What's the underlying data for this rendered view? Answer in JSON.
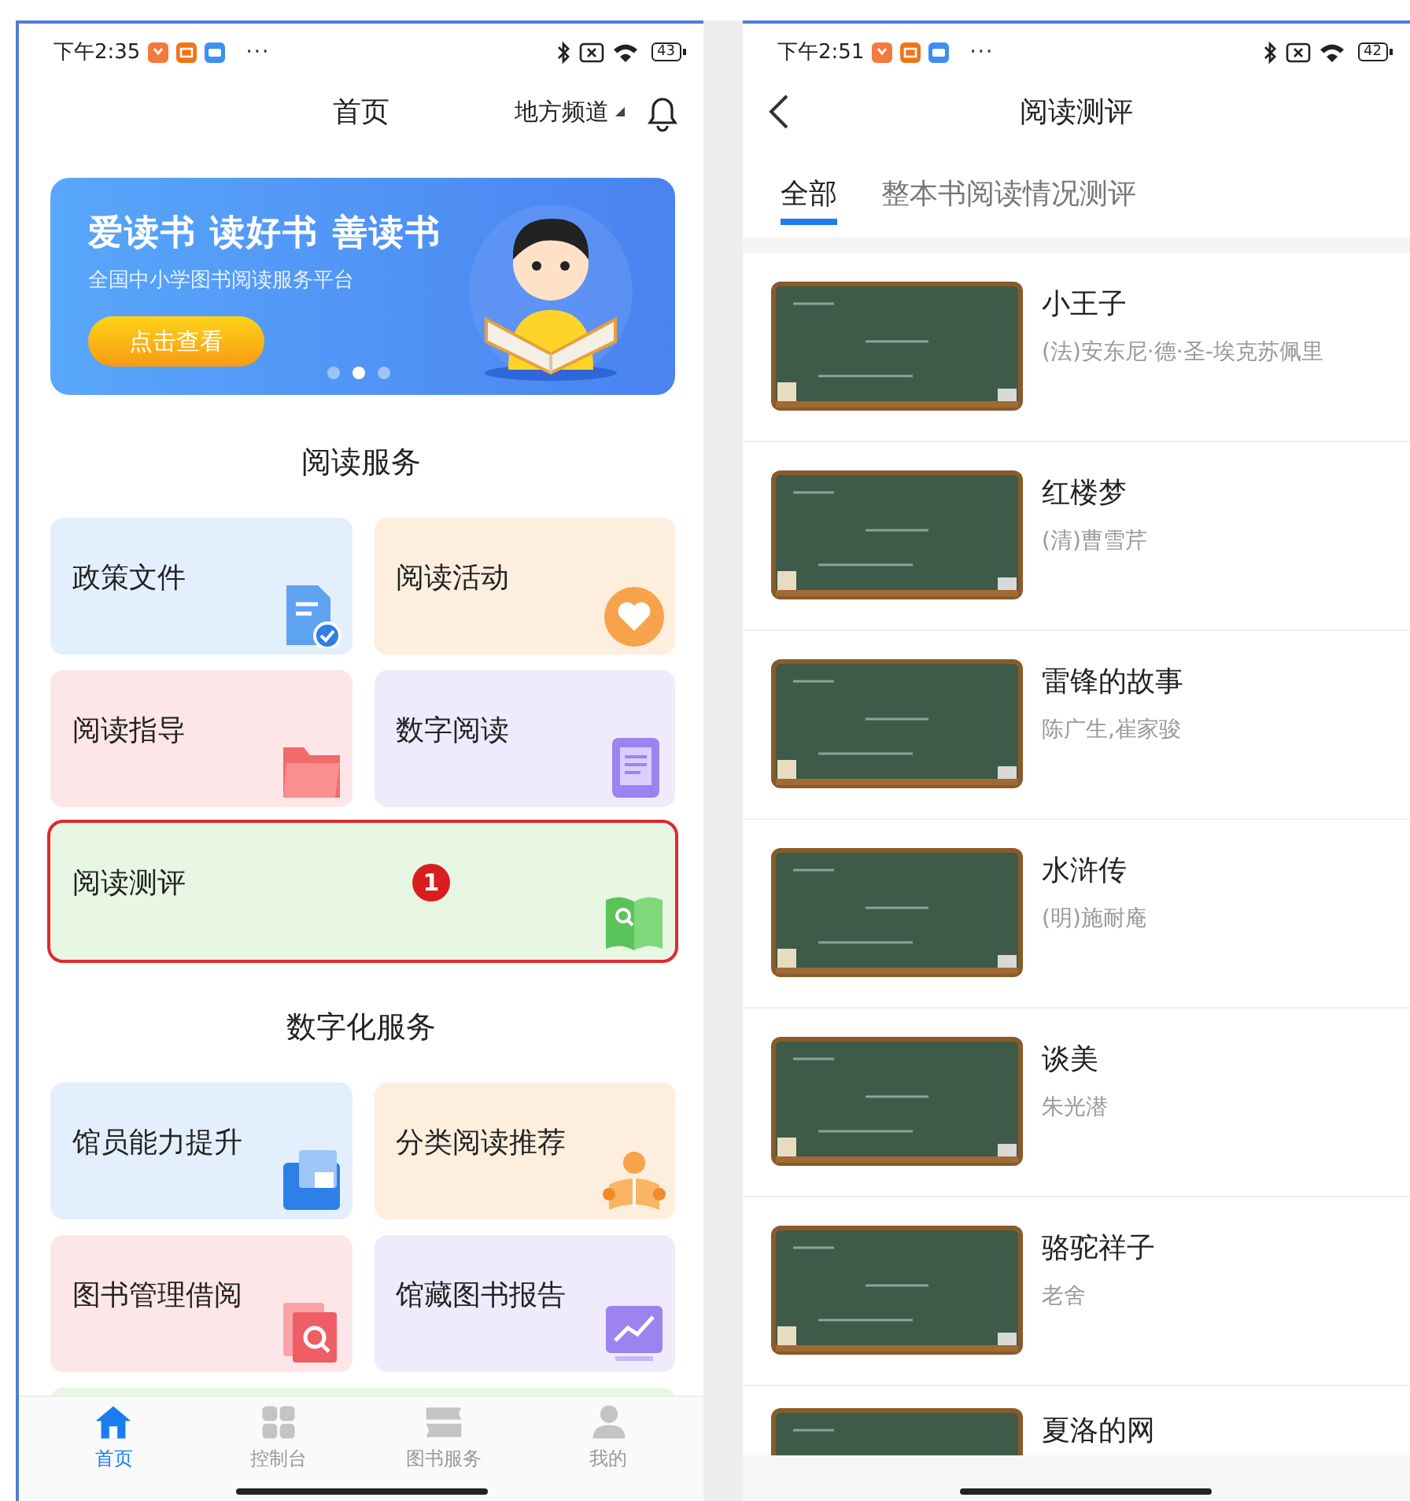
{
  "home": {
    "status_bar": {
      "time": "下午2:35",
      "overflow": "···",
      "battery": "43"
    },
    "header": {
      "title": "首页",
      "channel": "地方频道"
    },
    "banner": {
      "headline": "爱读书 读好书 善读书",
      "subtitle": "全国中小学图书阅读服务平台",
      "button": "点击查看",
      "dots": [
        {
          "selected": false
        },
        {
          "selected": true
        },
        {
          "selected": false
        }
      ]
    },
    "sections": [
      {
        "title": "阅读服务",
        "tiles": [
          {
            "label": "政策文件",
            "kind": "document",
            "color": "#e4effd",
            "highlighted": false
          },
          {
            "label": "阅读活动",
            "kind": "heart",
            "color": "#fdeede",
            "highlighted": false
          },
          {
            "label": "阅读指导",
            "kind": "folder",
            "color": "#fde6e8",
            "highlighted": false
          },
          {
            "label": "数字阅读",
            "kind": "ebook",
            "color": "#efebfd",
            "highlighted": false
          },
          {
            "label": "阅读测评",
            "kind": "book",
            "color": "#e8f6e4",
            "highlighted": true,
            "marker": "1"
          }
        ]
      },
      {
        "title": "数字化服务",
        "tiles": [
          {
            "label": "馆员能力提升",
            "kind": "idcard",
            "color": "#e4effd",
            "highlighted": false
          },
          {
            "label": "分类阅读推荐",
            "kind": "reader",
            "color": "#fdeede",
            "highlighted": false
          },
          {
            "label": "图书管理借阅",
            "kind": "search",
            "color": "#fde6e8",
            "highlighted": false
          },
          {
            "label": "馆藏图书报告",
            "kind": "chart",
            "color": "#efebfd",
            "highlighted": false
          }
        ]
      }
    ],
    "tab_bar": [
      {
        "label": "首页",
        "kind": "home",
        "selected": true
      },
      {
        "label": "控制台",
        "kind": "grid",
        "selected": false
      },
      {
        "label": "图书服务",
        "kind": "books",
        "selected": false
      },
      {
        "label": "我的",
        "kind": "person",
        "selected": false
      }
    ]
  },
  "evaluation": {
    "status_bar": {
      "time": "下午2:51",
      "overflow": "···",
      "battery": "42"
    },
    "title": "阅读测评",
    "tabs": [
      {
        "label": "全部",
        "selected": true
      },
      {
        "label": "整本书阅读情况测评",
        "selected": false
      }
    ],
    "books": [
      {
        "title": "小王子",
        "author": "(法)安东尼·德·圣-埃克苏佩里"
      },
      {
        "title": "红楼梦",
        "author": "(清)曹雪芹"
      },
      {
        "title": "雷锋的故事",
        "author": "陈广生,崔家骏"
      },
      {
        "title": "水浒传",
        "author": "(明)施耐庵"
      },
      {
        "title": "谈美",
        "author": "朱光潜"
      },
      {
        "title": "骆驼祥子",
        "author": "老舍"
      },
      {
        "title": "夏洛的网"
      }
    ]
  }
}
